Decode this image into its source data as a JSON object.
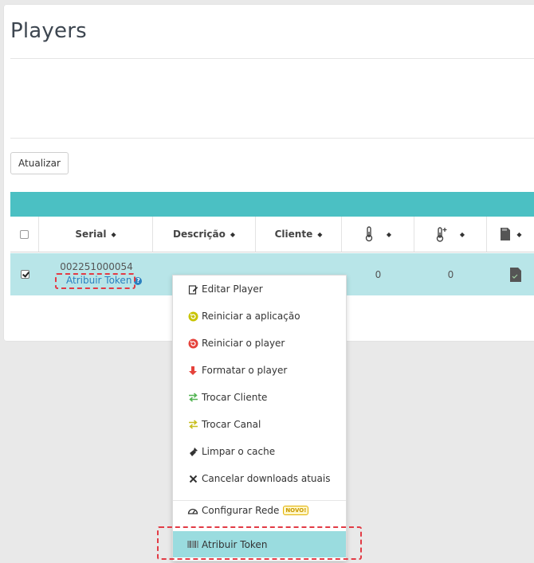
{
  "page": {
    "title": "Players"
  },
  "toolbar": {
    "refresh_label": "Atualizar"
  },
  "table": {
    "columns": {
      "serial": "Serial",
      "descricao": "Descrição",
      "cliente": "Cliente"
    },
    "rows": [
      {
        "checked": true,
        "serial": "002251000054",
        "token_link": "Atribuir Token",
        "temp": "0",
        "temp_max": "0"
      }
    ]
  },
  "context_menu": {
    "items": [
      {
        "label": "Editar Player",
        "icon": "edit-icon"
      },
      {
        "label": "Reiniciar a aplicação",
        "icon": "restart-app-icon"
      },
      {
        "label": "Reiniciar o player",
        "icon": "restart-player-icon"
      },
      {
        "label": "Formatar o player",
        "icon": "format-down-arrow-icon"
      },
      {
        "label": "Trocar Cliente",
        "icon": "swap-client-icon"
      },
      {
        "label": "Trocar Canal",
        "icon": "swap-channel-icon"
      },
      {
        "label": "Limpar o cache",
        "icon": "broom-icon"
      },
      {
        "label": "Cancelar downloads atuais",
        "icon": "cancel-x-icon"
      },
      {
        "label": "Configurar Rede",
        "icon": "network-gauge-icon",
        "badge": "NOVO!"
      },
      {
        "label": "Atribuir Token",
        "icon": "barcode-icon",
        "active": true
      }
    ]
  },
  "colors": {
    "teal_header": "#4bc0c3",
    "row_selected": "#b8e5e8",
    "menu_active": "#9adcdf",
    "highlight": "#e23b45",
    "link": "#2a7fbf"
  }
}
